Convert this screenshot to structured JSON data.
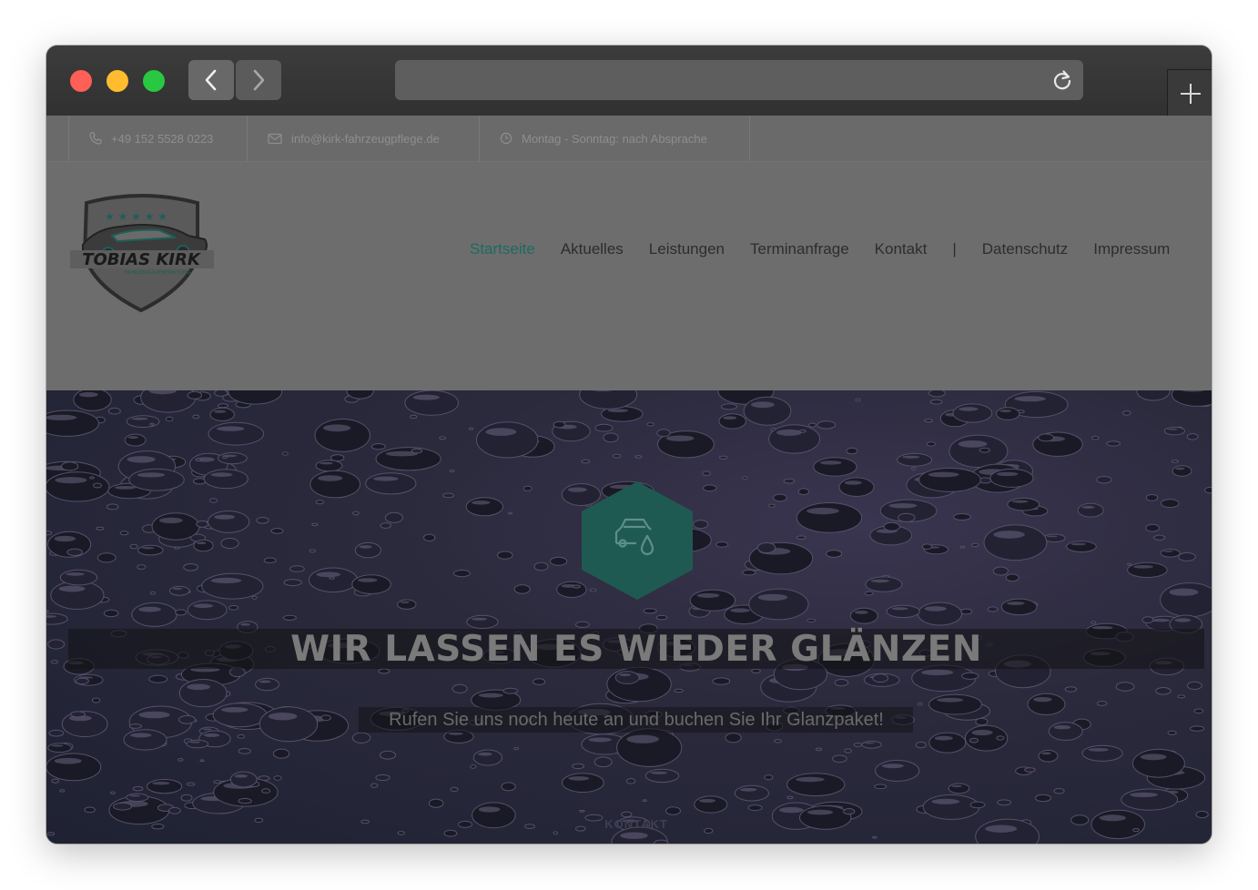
{
  "contact_bar": {
    "phone": "+49 152 5528 0223",
    "email": "info@kirk-fahrzeugpflege.de",
    "hours": "Montag - Sonntag: nach Absprache"
  },
  "logo": {
    "name": "TOBIAS KIRK",
    "tagline": "FAHRZEUGAUFBEREITUNG"
  },
  "nav": {
    "items": [
      "Startseite",
      "Aktuelles",
      "Leistungen",
      "Terminanfrage",
      "Kontakt",
      "|",
      "Datenschutz",
      "Impressum"
    ],
    "active": "Startseite"
  },
  "hero": {
    "headline": "WIR LASSEN ES WIEDER GLÄNZEN",
    "subline": "Rufen Sie uns noch heute an und buchen Sie Ihr Glanzpaket!",
    "cta": "KONTAKT"
  },
  "colors": {
    "accent": "#1d6a62",
    "hex_badge": "#1e5a52"
  }
}
